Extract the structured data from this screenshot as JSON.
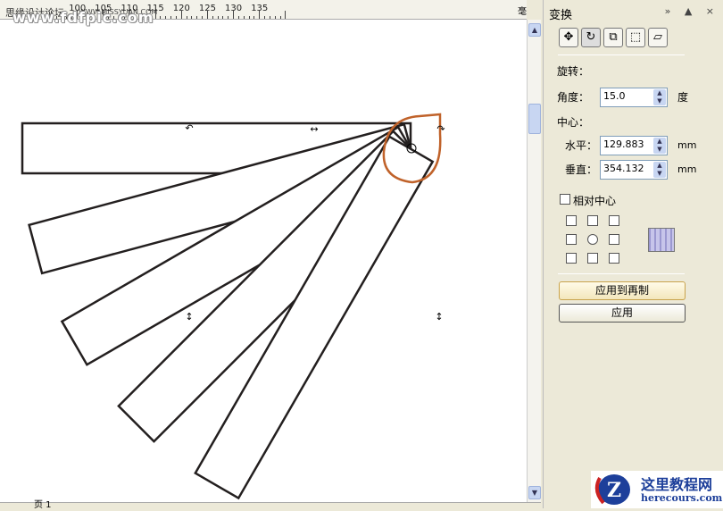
{
  "ruler": {
    "labels": [
      "100",
      "105",
      "110",
      "115",
      "120",
      "125",
      "130",
      "135"
    ],
    "unit": "毫米",
    "watermark_cn": "思缘设计论坛",
    "watermark_url": "WWW.MISSYUAN.COM",
    "watermark_2": "www.fdfpic.com"
  },
  "canvas": {
    "rotation_step_deg": 15,
    "copies": 5,
    "selection_color": "#c0622a"
  },
  "page_tab": "页 1",
  "panel": {
    "title": "变换",
    "controls": "» ▲ ×",
    "section": "旋转：",
    "angle_label": "角度：",
    "angle_value": "15.0",
    "angle_unit": "度",
    "center_label": "中心：",
    "h_label": "水平：",
    "h_value": "129.883",
    "h_unit": "mm",
    "v_label": "垂直：",
    "v_value": "354.132",
    "v_unit": "mm",
    "relative_label": "相对中心",
    "relative_checked": false,
    "apply_copy": "应用到再制",
    "apply": "应用"
  },
  "logo": {
    "name": "这里教程网",
    "url": "herecours.com"
  }
}
